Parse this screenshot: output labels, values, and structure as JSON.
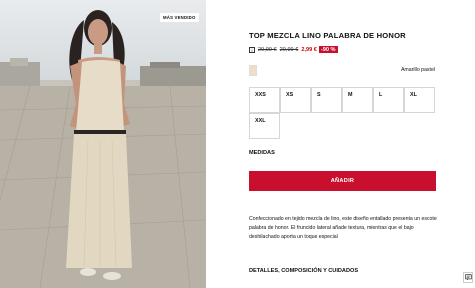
{
  "product": {
    "badge": "MÁS VENDIDO",
    "title": "TOP MEZCLA LINO PALABRA DE HONOR",
    "price_info_icon": "i",
    "old_price_1": "29,99 €",
    "old_price_2": "20,99 €",
    "new_price": "2,99 €",
    "discount": "-90 %",
    "color_name": "Amarillo pastel",
    "color_swatch": "#f0dfc6",
    "sizes": [
      "XXS",
      "XS",
      "S",
      "M",
      "L",
      "XL",
      "XXL"
    ],
    "measures_label": "MEDIDAS",
    "add_button": "AÑADIR",
    "description": "Confeccionado en tejido mezcla de lino, este diseño entallado presenta un escote palabra de honor. El fruncido lateral añade textura, mientras que el bajo deshilachado aporta un toque especial",
    "details_label": "DETALLES, COMPOSICIÓN Y CUIDADOS"
  },
  "colors": {
    "accent": "#c8102e",
    "sale_text": "#d10000"
  },
  "icons": {
    "chat": "chat-icon"
  }
}
